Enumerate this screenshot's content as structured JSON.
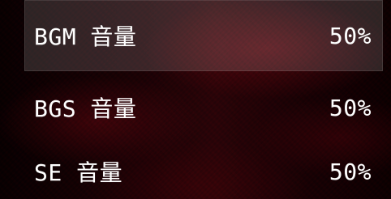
{
  "volume_menu": {
    "rows": [
      {
        "label": "BGM 音量",
        "value": "50%"
      },
      {
        "label": "BGS 音量",
        "value": "50%"
      },
      {
        "label": "SE 音量",
        "value": "50%"
      }
    ],
    "selected_index": 0
  },
  "colors": {
    "text": "#ffffff",
    "background_dark": "#070102",
    "background_red": "#2a0509",
    "selection_highlight": "#ffffff24"
  }
}
